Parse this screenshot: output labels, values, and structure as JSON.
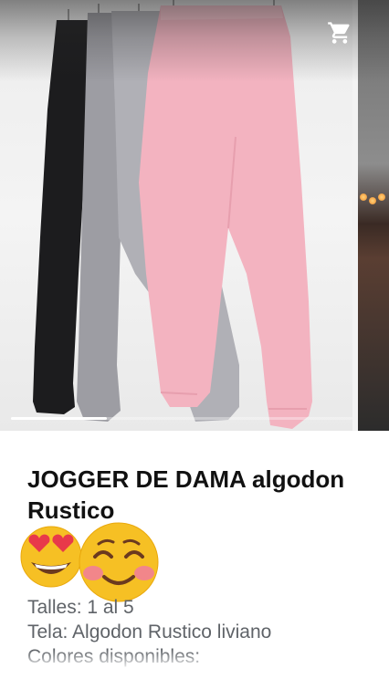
{
  "gallery": {
    "cart_icon": "shopping-cart-icon",
    "image_description": "pants-photo",
    "slide_progress": 0.28,
    "colors": {
      "black": "#1c1c1e",
      "gray": "#a3a3a8",
      "pink": "#f3b3c0"
    }
  },
  "post": {
    "title": "JOGGER DE DAMA algodon Rustico",
    "emojis": [
      "smiling-face-with-heart-eyes-icon",
      "smiling-face-with-smiling-eyes-icon"
    ],
    "details": [
      "Talles: 1 al 5",
      "Tela: Algodon Rustico liviano",
      "Colores disponibles:"
    ]
  }
}
